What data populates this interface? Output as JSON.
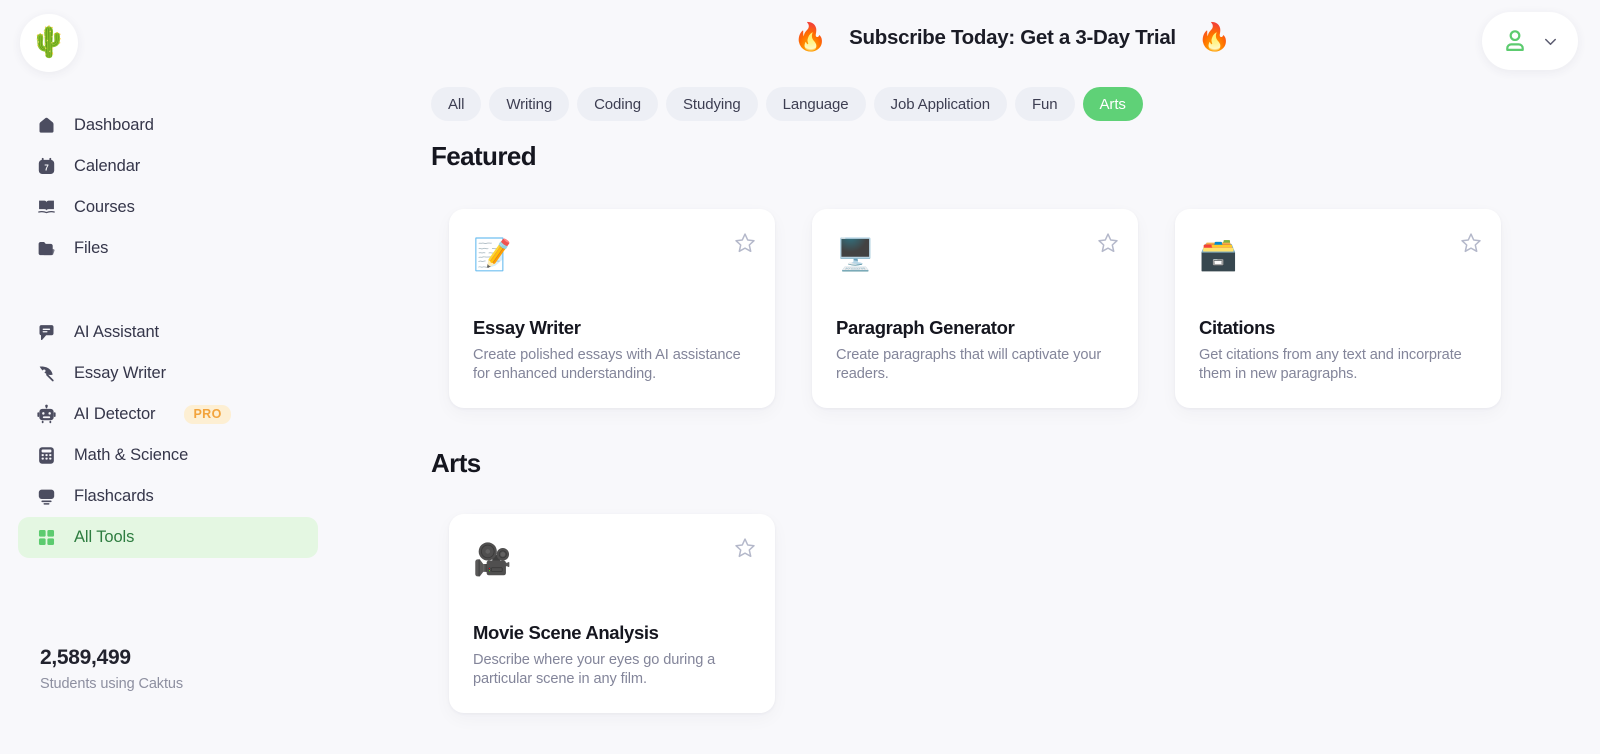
{
  "brand": {
    "logo_icon": "cactus-logo",
    "logo_glyph": "🌵",
    "name": "Caktus"
  },
  "colors": {
    "accent_green": "#5FD177",
    "active_nav_bg": "#E4F7E2",
    "active_nav_text": "#2E7D40",
    "pro_badge_bg": "#FDEFD3",
    "pro_badge_text": "#F2A33C",
    "page_bg": "#F8F8FB",
    "card_bg": "#FFFFFF",
    "tab_bg": "#EDEFF5",
    "star_outline": "#B4B8CA",
    "icon_slate": "#4C4D60"
  },
  "topbar": {
    "promo": {
      "text": "Subscribe Today: Get a 3-Day Trial",
      "left_icon": "fire-icon",
      "left_glyph": "🔥",
      "right_icon": "fire-icon",
      "right_glyph": "🔥"
    },
    "account": {
      "user_icon": "user-icon",
      "chevron_icon": "chevron-down-icon"
    }
  },
  "sidebar": {
    "groups": [
      {
        "items": [
          {
            "label": "Dashboard",
            "icon": "home-icon",
            "active": false
          },
          {
            "label": "Calendar",
            "icon": "calendar-icon",
            "active": false,
            "icon_text": "7"
          },
          {
            "label": "Courses",
            "icon": "book-icon",
            "active": false
          },
          {
            "label": "Files",
            "icon": "folder-icon",
            "active": false
          }
        ]
      },
      {
        "items": [
          {
            "label": "AI Assistant",
            "icon": "chat-bubble-icon",
            "active": false
          },
          {
            "label": "Essay Writer",
            "icon": "pen-nib-icon",
            "active": false
          },
          {
            "label": "AI Detector",
            "icon": "robot-icon",
            "active": false,
            "badge": "PRO"
          },
          {
            "label": "Math & Science",
            "icon": "calculator-icon",
            "active": false
          },
          {
            "label": "Flashcards",
            "icon": "flashcards-icon",
            "active": false
          },
          {
            "label": "All Tools",
            "icon": "grid-icon",
            "active": true
          }
        ]
      }
    ],
    "stats": {
      "number": "2,589,499",
      "caption": "Students using Caktus"
    }
  },
  "main": {
    "tabs": [
      {
        "label": "All",
        "active": false
      },
      {
        "label": "Writing",
        "active": false
      },
      {
        "label": "Coding",
        "active": false
      },
      {
        "label": "Studying",
        "active": false
      },
      {
        "label": "Language",
        "active": false
      },
      {
        "label": "Job Application",
        "active": false
      },
      {
        "label": "Fun",
        "active": false
      },
      {
        "label": "Arts",
        "active": true
      }
    ],
    "sections": [
      {
        "title": "Featured",
        "cards": [
          {
            "name": "Essay Writer",
            "description": "Create polished essays with AI assistance for enhanced understanding.",
            "icon": "memo-pencil-icon",
            "glyph": "📝",
            "favorite_icon": "star-outline-icon",
            "favorited": false
          },
          {
            "name": "Paragraph Generator",
            "description": "Create paragraphs that will captivate your readers.",
            "icon": "desktop-memo-icon",
            "glyph": "🖥️",
            "favorite_icon": "star-outline-icon",
            "favorited": false
          },
          {
            "name": "Citations",
            "description": "Get citations from any text and incorprate them in new paragraphs.",
            "icon": "card-file-box-icon",
            "glyph": "🗃️",
            "favorite_icon": "star-outline-icon",
            "favorited": false
          }
        ]
      },
      {
        "title": "Arts",
        "cards": [
          {
            "name": "Movie Scene Analysis",
            "description": "Describe where your eyes go during a particular scene in any film.",
            "icon": "movie-camera-icon",
            "glyph": "🎥",
            "favorite_icon": "star-outline-icon",
            "favorited": false
          }
        ]
      }
    ]
  }
}
